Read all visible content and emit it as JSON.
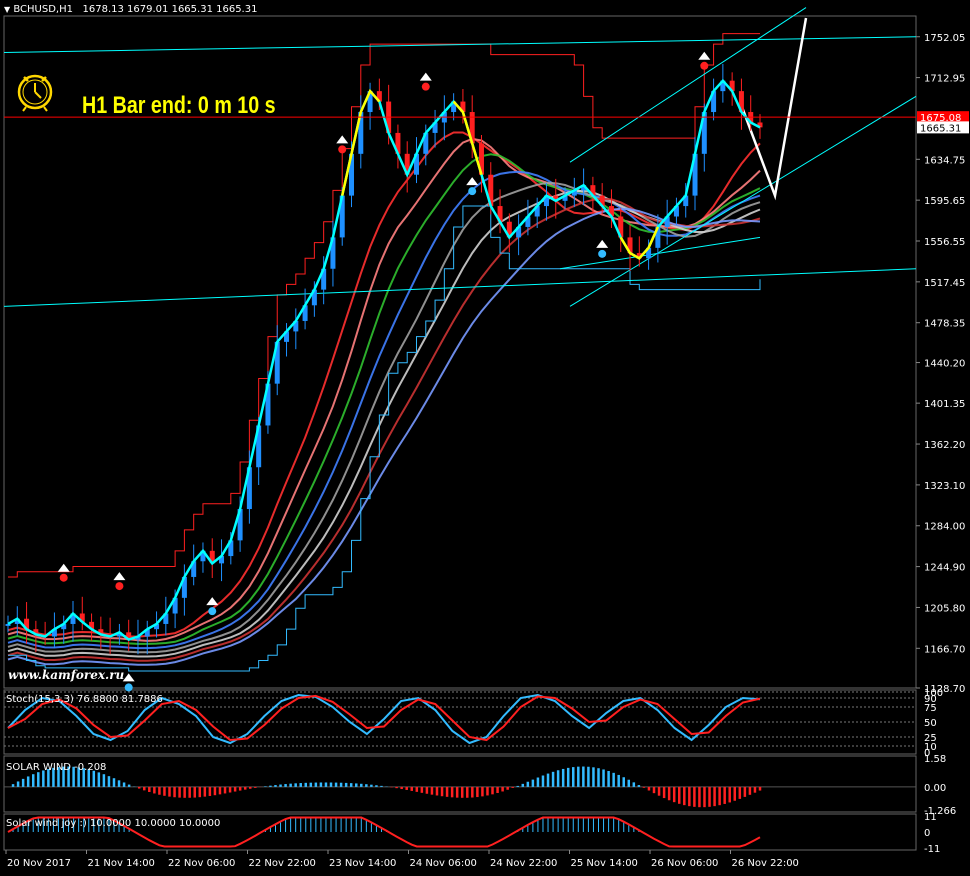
{
  "header": {
    "symbol": "BCHUSD,H1",
    "ohlc": "1678.13 1679.01 1665.31 1665.31"
  },
  "timer_label": "H1 Bar end: 0 m 10 s",
  "watermark": "www.kamforex.ru",
  "colors": {
    "background": "#000000",
    "bull_candle": "#1e90ff",
    "bear_candle": "#ff2020",
    "channel": "#00ffff",
    "timer_text": "#ffff00",
    "price_line": "#ff0000",
    "stoch_main": "#33bbff",
    "stoch_signal": "#ff2020",
    "histogram_pos": "#33bbff",
    "histogram_neg": "#ff2020"
  },
  "icons": [
    "alarm-clock-icon",
    "fractal-arrow-up-icon",
    "fractal-arrow-down-icon",
    "dropdown-triangle-icon"
  ],
  "chart_data": [
    {
      "type": "line",
      "title": "",
      "ylim": [
        1128.7,
        1770
      ],
      "y_ticks": [
        "1752.05",
        "1712.95",
        "1634.75",
        "1595.65",
        "1556.55",
        "1517.45",
        "1478.35",
        "1440.20",
        "1401.35",
        "1362.20",
        "1323.10",
        "1284.00",
        "1244.90",
        "1205.80",
        "1166.70",
        "1128.70"
      ],
      "current_price_box": "1675.08",
      "bid_box": "1665.31",
      "x_tick_labels": [
        "20 Nov 2017",
        "21 Nov 14:00",
        "22 Nov 06:00",
        "22 Nov 22:00",
        "23 Nov 14:00",
        "24 Nov 06:00",
        "24 Nov 22:00",
        "25 Nov 14:00",
        "26 Nov 06:00",
        "26 Nov 22:00"
      ],
      "series": [
        {
          "values": [
            1190,
            1195,
            1185,
            1180,
            1178,
            1185,
            1190,
            1200,
            1192,
            1185,
            1180,
            1178,
            1182,
            1175,
            1178,
            1185,
            1190,
            1200,
            1215,
            1235,
            1250,
            1260,
            1248,
            1255,
            1270,
            1300,
            1340,
            1380,
            1420,
            1460,
            1470,
            1480,
            1495,
            1510,
            1530,
            1560,
            1600,
            1640,
            1680,
            1700,
            1690,
            1660,
            1640,
            1620,
            1640,
            1660,
            1670,
            1680,
            1690,
            1680,
            1650,
            1620,
            1590,
            1575,
            1560,
            1570,
            1580,
            1590,
            1600,
            1595,
            1600,
            1605,
            1610,
            1600,
            1590,
            1580,
            1560,
            1545,
            1540,
            1550,
            1570,
            1580,
            1590,
            1600,
            1640,
            1680,
            1700,
            1710,
            1700,
            1680,
            1670,
            1665.31
          ]
        }
      ]
    },
    {
      "type": "line",
      "title": "Stoch(15,3,3) 76.8800 81.7886",
      "ylim": [
        0,
        100
      ],
      "y_ticks": [
        "100",
        "90",
        "75",
        "50",
        "25",
        "10",
        "0"
      ]
    },
    {
      "type": "bar",
      "title": "SOLAR WIND -0.208",
      "ylim": [
        -1.266,
        1.58
      ],
      "y_ticks": [
        "1.58",
        "0.00",
        "-1.266"
      ]
    },
    {
      "type": "bar",
      "title": "Solar wind joy :) 10.0000 10.0000 10.0000",
      "ylim": [
        -11,
        11
      ],
      "y_ticks": [
        "11",
        "0",
        "-11"
      ]
    }
  ]
}
